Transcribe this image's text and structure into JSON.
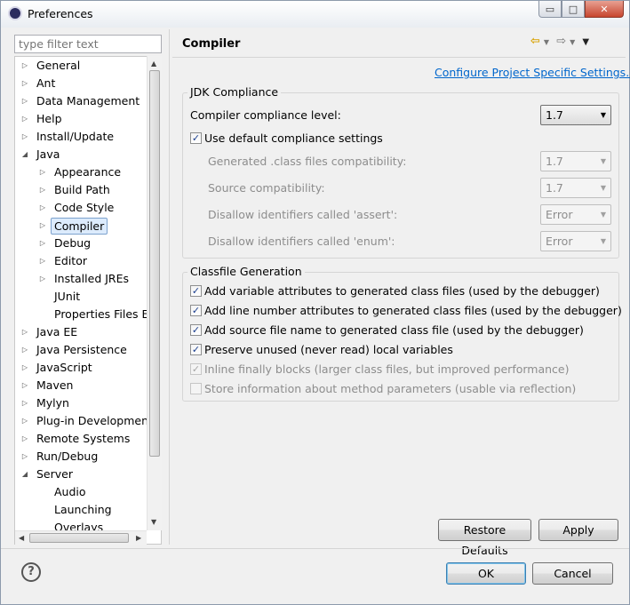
{
  "window": {
    "title": "Preferences",
    "minimize": "▭",
    "maximize": "□",
    "close": "✕"
  },
  "filter": {
    "placeholder": "type filter text"
  },
  "tree": {
    "items": [
      {
        "label": "General",
        "level": 0,
        "expander": "collapsed"
      },
      {
        "label": "Ant",
        "level": 0,
        "expander": "collapsed"
      },
      {
        "label": "Data Management",
        "level": 0,
        "expander": "collapsed"
      },
      {
        "label": "Help",
        "level": 0,
        "expander": "collapsed"
      },
      {
        "label": "Install/Update",
        "level": 0,
        "expander": "collapsed"
      },
      {
        "label": "Java",
        "level": 0,
        "expander": "expanded"
      },
      {
        "label": "Appearance",
        "level": 1,
        "expander": "collapsed"
      },
      {
        "label": "Build Path",
        "level": 1,
        "expander": "collapsed"
      },
      {
        "label": "Code Style",
        "level": 1,
        "expander": "collapsed"
      },
      {
        "label": "Compiler",
        "level": 1,
        "expander": "collapsed",
        "selected": true
      },
      {
        "label": "Debug",
        "level": 1,
        "expander": "collapsed"
      },
      {
        "label": "Editor",
        "level": 1,
        "expander": "collapsed"
      },
      {
        "label": "Installed JREs",
        "level": 1,
        "expander": "collapsed"
      },
      {
        "label": "JUnit",
        "level": 1,
        "expander": "none"
      },
      {
        "label": "Properties Files Ed",
        "level": 1,
        "expander": "none"
      },
      {
        "label": "Java EE",
        "level": 0,
        "expander": "collapsed"
      },
      {
        "label": "Java Persistence",
        "level": 0,
        "expander": "collapsed"
      },
      {
        "label": "JavaScript",
        "level": 0,
        "expander": "collapsed"
      },
      {
        "label": "Maven",
        "level": 0,
        "expander": "collapsed"
      },
      {
        "label": "Mylyn",
        "level": 0,
        "expander": "collapsed"
      },
      {
        "label": "Plug-in Development",
        "level": 0,
        "expander": "collapsed"
      },
      {
        "label": "Remote Systems",
        "level": 0,
        "expander": "collapsed"
      },
      {
        "label": "Run/Debug",
        "level": 0,
        "expander": "collapsed"
      },
      {
        "label": "Server",
        "level": 0,
        "expander": "expanded"
      },
      {
        "label": "Audio",
        "level": 1,
        "expander": "none"
      },
      {
        "label": "Launching",
        "level": 1,
        "expander": "none"
      },
      {
        "label": "Overlays",
        "level": 1,
        "expander": "none"
      }
    ]
  },
  "page": {
    "title": "Compiler",
    "configure_link": "Configure Project Specific Settings...",
    "jdk": {
      "group_title": "JDK Compliance",
      "compliance_label": "Compiler compliance level:",
      "compliance_value": "1.7",
      "use_default_label": "Use default compliance settings",
      "use_default_checked": true,
      "generated_label": "Generated .class files compatibility:",
      "generated_value": "1.7",
      "source_label": "Source compatibility:",
      "source_value": "1.7",
      "assert_label": "Disallow identifiers called 'assert':",
      "assert_value": "Error",
      "enum_label": "Disallow identifiers called 'enum':",
      "enum_value": "Error"
    },
    "classfile": {
      "group_title": "Classfile Generation",
      "options": [
        {
          "label": "Add variable attributes to generated class files (used by the debugger)",
          "checked": true,
          "enabled": true
        },
        {
          "label": "Add line number attributes to generated class files (used by the debugger)",
          "checked": true,
          "enabled": true
        },
        {
          "label": "Add source file name to generated class file (used by the debugger)",
          "checked": true,
          "enabled": true
        },
        {
          "label": "Preserve unused (never read) local variables",
          "checked": true,
          "enabled": true
        },
        {
          "label": "Inline finally blocks (larger class files, but improved performance)",
          "checked": true,
          "enabled": false
        },
        {
          "label": "Store information about method parameters (usable via reflection)",
          "checked": false,
          "enabled": false
        }
      ]
    },
    "restore_label": "Restore Defaults",
    "apply_label": "Apply"
  },
  "footer": {
    "ok_label": "OK",
    "cancel_label": "Cancel",
    "help_glyph": "?"
  },
  "colors": {
    "link": "#0066cc",
    "selection": "#dcebfc",
    "default_button_border": "#3c7fb1"
  }
}
